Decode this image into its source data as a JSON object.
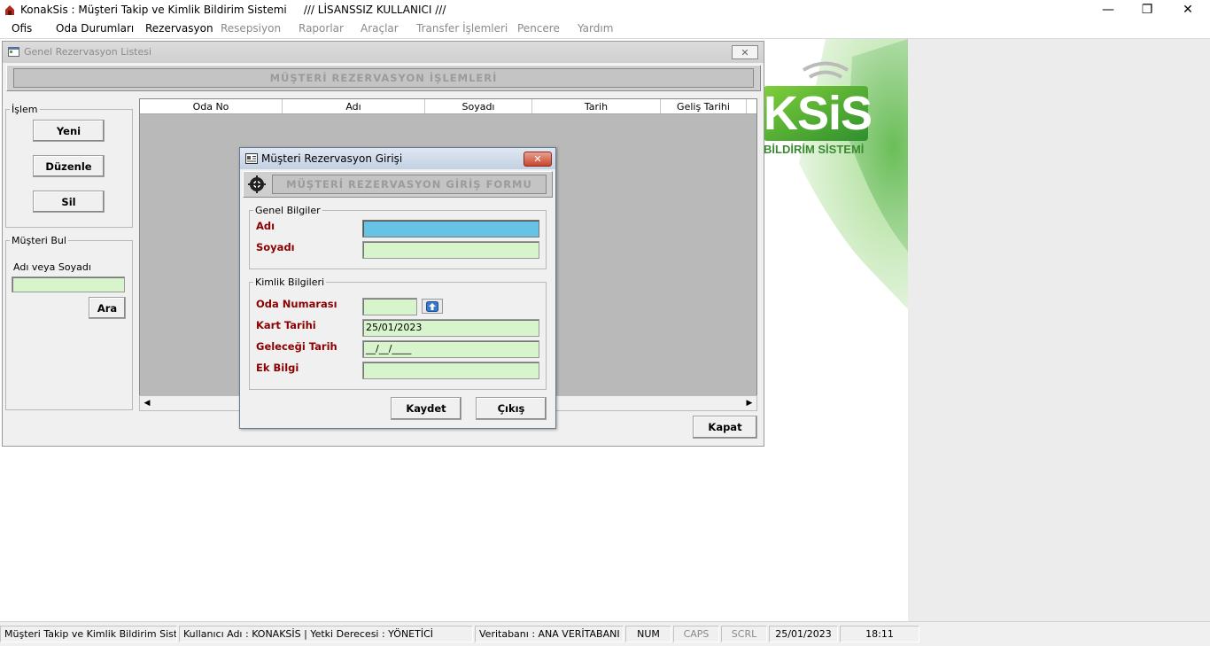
{
  "window": {
    "title": "KonakSis : Müşteri Takip ve Kimlik Bildirim Sistemi     /// LİSANSSIZ KULLANICI ///",
    "minimize": "—",
    "maximize": "❐",
    "close": "✕"
  },
  "menu": [
    "Ofis",
    "Oda Durumları",
    "Rezervasyon",
    "Resepsiyon",
    "Raporlar",
    "Araçlar",
    "Transfer İşlemleri",
    "Pencere",
    "Yardım"
  ],
  "logo": {
    "text": "KSiS",
    "subtitle": "BİLDİRİM SİSTEMİ"
  },
  "list_window": {
    "title": "Genel Rezervasyon Listesi",
    "close": "✕",
    "header": "MÜŞTERİ REZERVASYON İŞLEMLERİ",
    "islem_group": "İşlem",
    "buttons": {
      "new": "Yeni",
      "edit": "Düzenle",
      "delete": "Sil"
    },
    "find_group": "Müşteri Bul",
    "find_label": "Adı veya Soyadı",
    "find_value": "",
    "find_button": "Ara",
    "columns": [
      "Oda No",
      "Adı",
      "Soyadı",
      "Tarih",
      "Geliş Tarihi"
    ],
    "scroll_left": "◀",
    "scroll_right": "▶",
    "close_button": "Kapat"
  },
  "dialog": {
    "title": "Müşteri Rezervasyon Girişi",
    "close": "✕",
    "header": "MÜŞTERİ REZERVASYON GİRİŞ FORMU",
    "general_group": "Genel Bilgiler",
    "name_label": "Adı",
    "name_value": "",
    "surname_label": "Soyadı",
    "surname_value": "",
    "identity_group": "Kimlik Bilgileri",
    "room_label": "Oda Numarası",
    "room_value": "",
    "room_button": "⇧",
    "card_date_label": "Kart Tarihi",
    "card_date_value": "25/01/2023",
    "arrival_label": "Geleceği Tarih",
    "arrival_value": "__/__/____",
    "extra_label": "Ek Bilgi",
    "extra_value": "",
    "save_button": "Kaydet",
    "exit_button": "Çıkış"
  },
  "statusbar": {
    "app": "Müşteri Takip ve Kimlik Bildirim Sistemi",
    "user": "Kullanıcı Adı : KONAKSİS    |   Yetki Derecesi : YÖNETİCİ",
    "db": "Veritabanı : ANA VERİTABANI",
    "num": "NUM",
    "caps": "CAPS",
    "scrl": "SCRL",
    "date": "25/01/2023",
    "time": "18:11"
  },
  "colors": {
    "green_input": "#d7f4cd",
    "focus_input": "#66c3e6",
    "label_red": "#8b0000",
    "logo_green": "#3fa63a"
  }
}
